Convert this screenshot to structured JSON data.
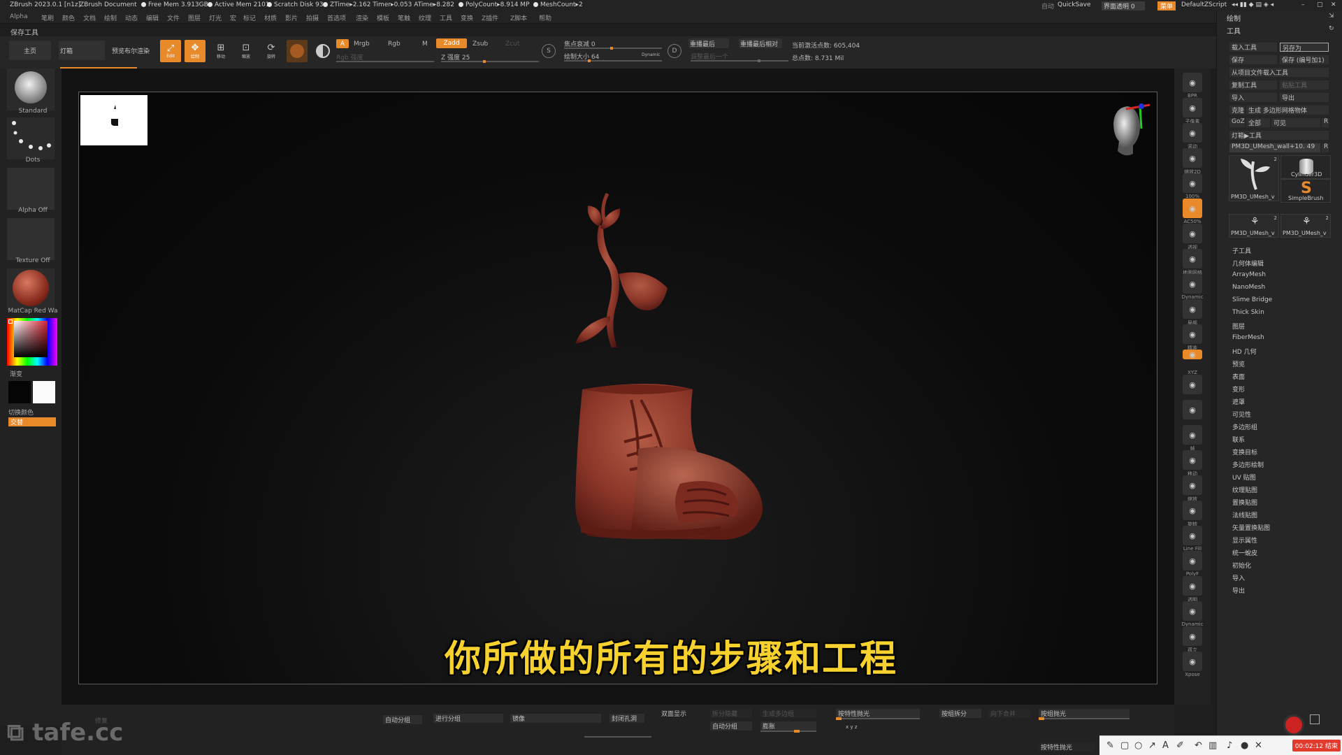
{
  "titlebar": {
    "app": "ZBrush 2023.0.1 [n1z]",
    "doc": "ZBrush Document",
    "free_mem": "Free Mem 3.913GB",
    "active_mem": "Active Mem 2101",
    "scratch": "Scratch Disk 93",
    "ztime": "ZTime▸2.162 Timer▸0.053 ATime▸8.282",
    "polycount": "PolyCount▸8.914 MP",
    "meshcount": "MeshCount▸2",
    "auto": "自动",
    "quicksave": "QuickSave",
    "transparency": "界面透明 0",
    "menu": "菜单",
    "script": "DefaultZScript"
  },
  "menubar": [
    "Alpha",
    "笔刷",
    "颜色",
    "文档",
    "绘制",
    "动态",
    "编辑",
    "文件",
    "图层",
    "灯光",
    "宏",
    "标记",
    "材质",
    "影片",
    "拍摄",
    "首选项",
    "渲染",
    "模板",
    "笔触",
    "纹理",
    "工具",
    "变换",
    "Z插件",
    "Z脚本",
    "帮助"
  ],
  "palette_title": "保存工具",
  "toolbar": {
    "home": "主页",
    "lightbox": "灯箱",
    "preview": "预览布尔渲染",
    "edit": "Edit",
    "draw": "绘制",
    "move": "移动",
    "scale": "缩放",
    "rotate": "旋转",
    "a": "A",
    "mrgb": "Mrgb",
    "rgb": "Rgb",
    "m": "M",
    "zadd": "Zadd",
    "zsub": "Zsub",
    "zcut": "Zcut",
    "rgb_intensity": "Rgb 强度",
    "z_intensity": "Z 强度 25",
    "focal_shift": "焦点衰减 0",
    "draw_size": "绘制大小 64",
    "dynamic": "Dynamic",
    "replay_last": "重播最后",
    "replay_last_rel": "重播最后相对",
    "adjust_last": "调整最后一个",
    "active_points": "当前激活点数: 605,404",
    "total_points": "总点数: 8.731 Mil"
  },
  "leftpanel": {
    "brush": "Standard",
    "stroke": "Dots",
    "alpha": "Alpha Off",
    "texture": "Texture Off",
    "material": "MatCap Red Wa",
    "gradient": "渐变",
    "switch_color": "切换颜色",
    "alternate": "交替"
  },
  "subtitle": "你所做的所有的步骤和工程",
  "rightshelf": [
    "BPR",
    "子像素",
    "滚动",
    "缩放2D",
    "100%",
    "AC50%",
    "透视",
    "地面网格",
    "Dynamic",
    "局部",
    "精准",
    "XYZ",
    "",
    "",
    "帧",
    "移动",
    "缩放",
    "旋转",
    "Line Fill",
    "PolyF",
    "透明",
    "Dynamic",
    "孤立",
    "Xpose"
  ],
  "toolpanel": {
    "header1": "绘制",
    "header2": "工具",
    "load_tool": "载入工具",
    "save_as": "另存为",
    "save": "保存",
    "save_inc": "保存 (编号加1)",
    "load_from_project": "从项目文件载入工具",
    "copy_tool": "复制工具",
    "paste_tool": "粘贴工具",
    "import": "导入",
    "export": "导出",
    "clone": "克隆",
    "make_polymesh": "生成 多边形网格物体",
    "goz": "GoZ",
    "all": "全部",
    "visible": "可见",
    "r": "R",
    "lightbox_tools": "灯箱▶工具",
    "current_tool": "PM3D_UMesh_wall+10. 49",
    "tools": [
      {
        "name": "PM3D_UMesh_v",
        "count": "2"
      },
      {
        "name": "Cylinder3D",
        "count": ""
      },
      {
        "name": "SimpleBrush",
        "count": ""
      },
      {
        "name": "PM3D_UMesh_v",
        "count": "2"
      },
      {
        "name": "PM3D_UMesh_v",
        "count": "2"
      }
    ],
    "sections": [
      "子工具",
      "几何体编辑",
      "ArrayMesh",
      "NanoMesh",
      "Slime Bridge",
      "Thick Skin",
      "图层",
      "FiberMesh",
      "HD 几何",
      "预览",
      "表面",
      "变形",
      "遮罩",
      "可见性",
      "多边形组",
      "联系",
      "变换目标",
      "多边形绘制",
      "UV 贴图",
      "纹理贴图",
      "置换贴图",
      "法线贴图",
      "矢量置换贴图",
      "显示属性",
      "统一蛻皮",
      "初始化",
      "导入",
      "导出"
    ]
  },
  "bottombar": {
    "fix": "修复",
    "auto_group": "自动分组",
    "uv_group": "进行分组",
    "mirror": "镜像",
    "close_holes": "封闭孔洞",
    "double_side": "双面显示",
    "split_hidden": "拆分隐藏",
    "gen_polygroups": "生成多边组",
    "auto_group2": "自动分组",
    "polish_by_features": "按特性抛光",
    "split_by_groups": "按组拆分",
    "inflate": "膨胀",
    "merge_down": "向下合并",
    "polish_by_groups": "按组抛光",
    "xyz": "x y z",
    "polish_by_features2": "按特性抛光"
  },
  "watermark": "tafe.cc",
  "recorder": {
    "timer": "00:02:12 结束"
  },
  "colors": {
    "accent": "#e8892a",
    "model": "#8a3528",
    "subtitle": "#f7d12d"
  }
}
